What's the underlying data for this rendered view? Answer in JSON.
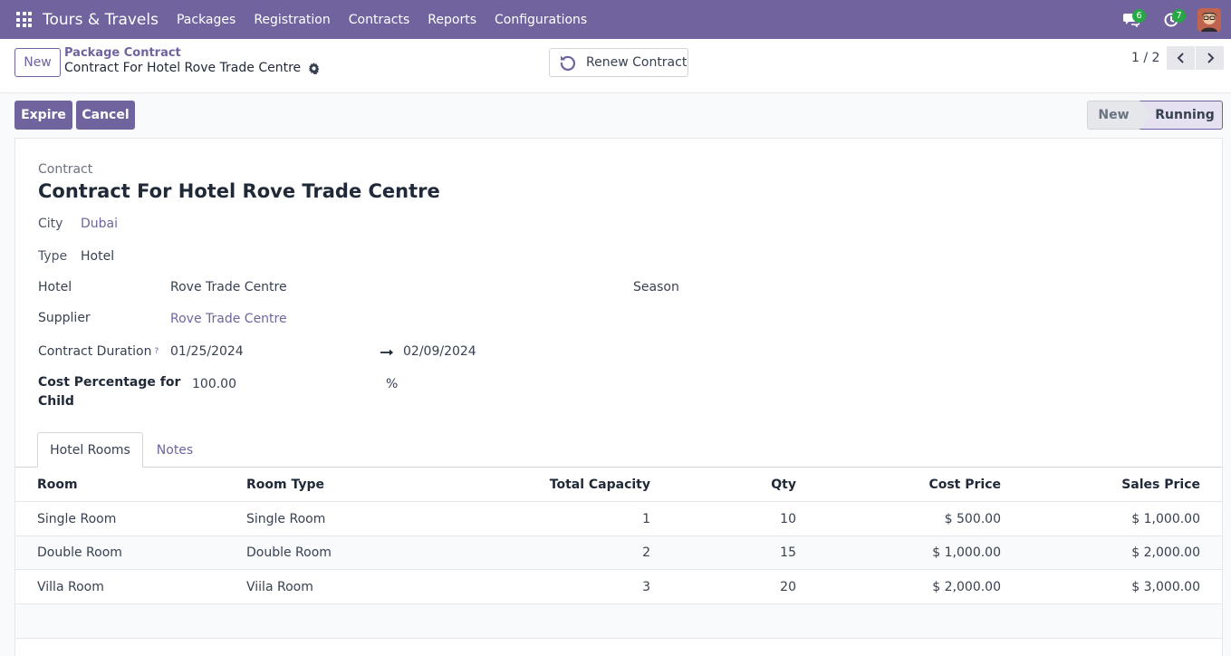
{
  "navbar": {
    "brand": "Tours & Travels",
    "menu": [
      "Packages",
      "Registration",
      "Contracts",
      "Reports",
      "Configurations"
    ],
    "messages_badge": "6",
    "activities_badge": "7",
    "accent_color": "#71639e",
    "badge_color": "#28a745"
  },
  "control_panel": {
    "new_label": "New",
    "breadcrumb_parent": "Package Contract",
    "breadcrumb_current": "Contract For Hotel Rove Trade Centre",
    "renew_label": "Renew Contract",
    "pager": "1 / 2"
  },
  "actions": {
    "expire_label": "Expire",
    "cancel_label": "Cancel"
  },
  "statusbar": {
    "stages": [
      "New",
      "Running"
    ],
    "current": "Running"
  },
  "form": {
    "contract_label": "Contract",
    "title": "Contract For Hotel Rove Trade Centre",
    "city_label": "City",
    "city": "Dubai",
    "type_label": "Type",
    "type": "Hotel",
    "hotel_label": "Hotel",
    "hotel": "Rove Trade Centre",
    "season_label": "Season",
    "supplier_label": "Supplier",
    "supplier": "Rove Trade Centre",
    "duration_label": "Contract Duration",
    "duration_help": "?",
    "start_date": "01/25/2024",
    "end_date": "02/09/2024",
    "cost_pct_label_1": "Cost Percentage for",
    "cost_pct_label_2": "Child",
    "cost_pct": "100.00",
    "cost_pct_unit": "%"
  },
  "tabs": {
    "hotel_rooms": "Hotel Rooms",
    "notes": "Notes"
  },
  "table": {
    "headers": {
      "room": "Room",
      "room_type": "Room Type",
      "total_capacity": "Total Capacity",
      "qty": "Qty",
      "cost_price": "Cost Price",
      "sales_price": "Sales Price"
    },
    "rows": [
      {
        "room": "Single Room",
        "room_type": "Single Room",
        "capacity": "1",
        "qty": "10",
        "cost": "$ 500.00",
        "sales": "$ 1,000.00"
      },
      {
        "room": "Double Room",
        "room_type": "Double Room",
        "capacity": "2",
        "qty": "15",
        "cost": "$ 1,000.00",
        "sales": "$ 2,000.00"
      },
      {
        "room": "Villa Room",
        "room_type": "Viila Room",
        "capacity": "3",
        "qty": "20",
        "cost": "$ 2,000.00",
        "sales": "$ 3,000.00"
      }
    ]
  }
}
